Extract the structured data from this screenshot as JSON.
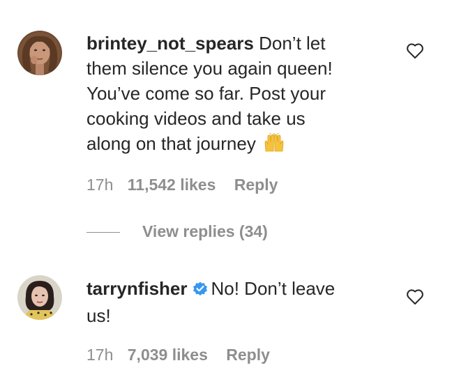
{
  "comments": [
    {
      "username": "brintey_not_spears",
      "text_lines": [
        "Don’t let",
        "them silence you again queen!",
        "You’ve come so far. Post your",
        "cooking videos and take us",
        "along on that journey"
      ],
      "emoji": "raising-hands",
      "time": "17h",
      "likes": "11,542 likes",
      "reply_label": "Reply",
      "view_replies_label": "View replies (34)"
    },
    {
      "username": "tarrynfisher",
      "verified": true,
      "text_lines": [
        "No! Don’t leave",
        "us!"
      ],
      "time": "17h",
      "likes": "7,039 likes",
      "reply_label": "Reply"
    }
  ],
  "colors": {
    "text": "#262626",
    "meta": "#8e8e8e",
    "verified": "#3897f0"
  },
  "icons": [
    "heart-icon",
    "verified-badge-icon",
    "raising-hands-emoji"
  ]
}
